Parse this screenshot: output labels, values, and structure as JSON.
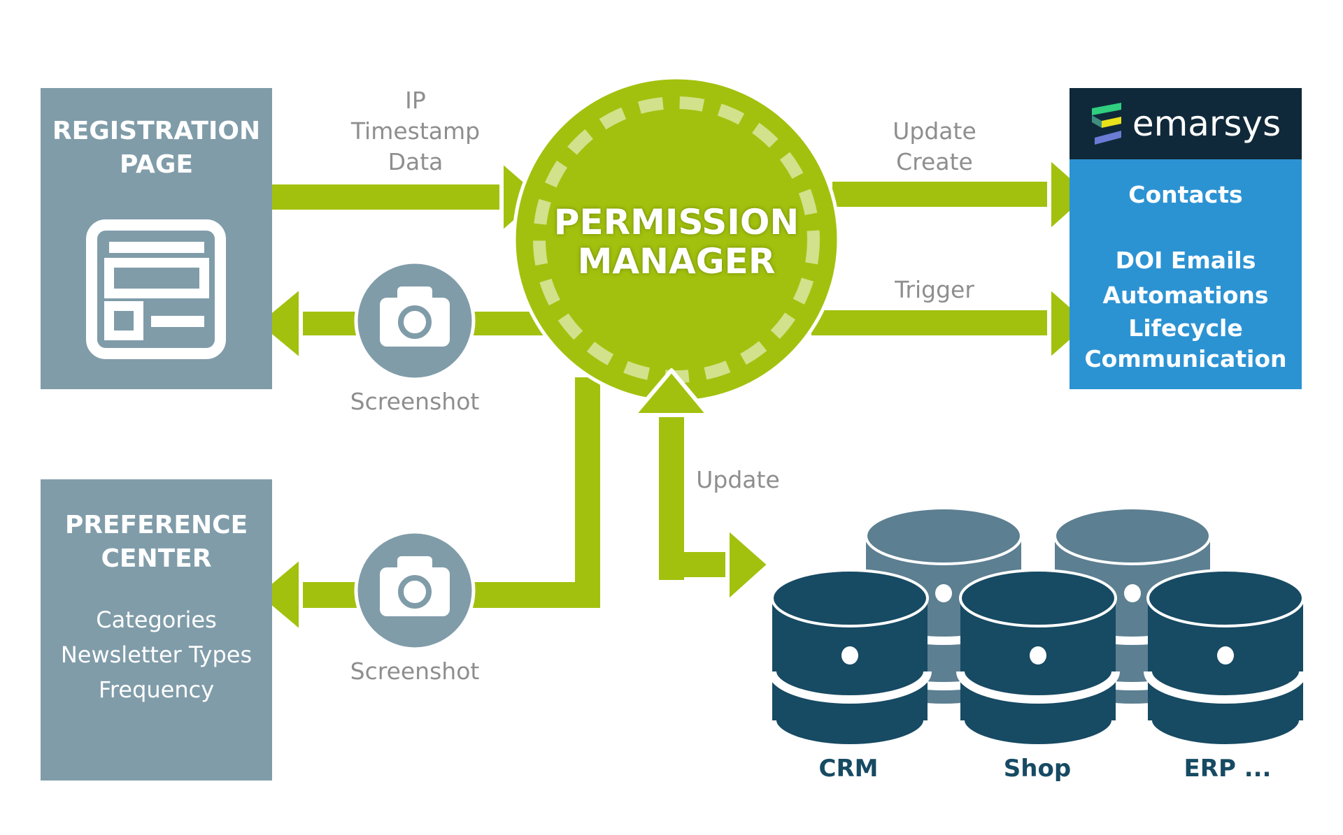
{
  "center": {
    "title_line1": "PERMISSION",
    "title_line2": "MANAGER"
  },
  "registration_page": {
    "title_line1": "REGISTRATION",
    "title_line2": "PAGE",
    "icon": "form-icon"
  },
  "preference_center": {
    "title_line1": "PREFERENCE",
    "title_line2": "CENTER",
    "items": [
      "Categories",
      "Newsletter Types",
      "Frequency"
    ]
  },
  "emarsys": {
    "brand": "emarsys",
    "items": [
      "Contacts",
      "DOI Emails",
      "Automations",
      "Lifecycle",
      "Communication"
    ]
  },
  "flows": {
    "registration_to_manager": [
      "IP",
      "Timestamp",
      "Data"
    ],
    "manager_to_emarsys_contacts": [
      "Update",
      "Create"
    ],
    "manager_to_emarsys_trigger": "Trigger",
    "screenshot_top": "Screenshot",
    "screenshot_bottom": "Screenshot",
    "databases_update": "Update"
  },
  "databases": {
    "labels": [
      "CRM",
      "Shop",
      "ERP ..."
    ]
  },
  "colors": {
    "arrow_green": "#a2c10e",
    "box_gray": "#809ca9",
    "emarsys_blue": "#2c93d3",
    "emarsys_dark": "#10293a",
    "db_dark": "#174a63",
    "db_light": "#5c7f91",
    "label_gray": "#8e8e8e"
  }
}
